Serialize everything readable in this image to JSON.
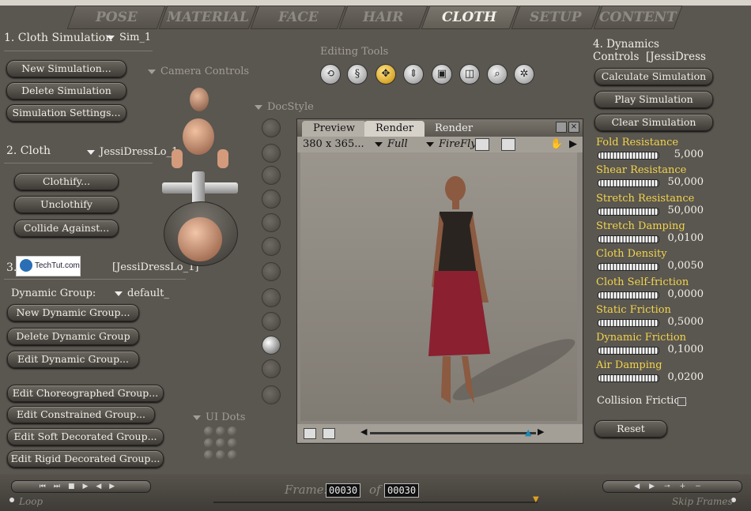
{
  "tabs": [
    "POSE",
    "MATERIAL",
    "FACE",
    "HAIR",
    "CLOTH",
    "SETUP",
    "CONTENT"
  ],
  "active_tab": "CLOTH",
  "sections": {
    "cloth_sim": {
      "title": "1. Cloth Simulation",
      "dropdown": "Sim_1",
      "buttons": [
        "New Simulation...",
        "Delete Simulation",
        "Simulation Settings..."
      ]
    },
    "cloth": {
      "title": "2. Cloth",
      "dropdown": "JessiDressLo_1",
      "buttons": [
        "Clothify...",
        "Unclothify",
        "Collide Against..."
      ]
    },
    "groups": {
      "title": "3.",
      "prop": "[JessiDressLo_1]",
      "watermark": "TechTut.com",
      "dyn_label": "Dynamic Group:",
      "dyn_value": "default_",
      "buttons": [
        "New Dynamic Group...",
        "Delete Dynamic Group",
        "Edit Dynamic Group...",
        "Edit Choreographed Group...",
        "Edit Constrained Group...",
        "Edit Soft Decorated Group...",
        "Edit Rigid Decorated Group..."
      ]
    }
  },
  "camera_controls": "Camera Controls",
  "doc_style": "DocStyle",
  "ui_dots": "UI Dots",
  "editing_tools": "Editing Tools",
  "window": {
    "tab_preview": "Preview",
    "tab_render": "Render",
    "tab_render2": "Render",
    "size": "380 x 365...",
    "mode": "Full",
    "renderer": "FireFly"
  },
  "dynamics": {
    "title": "4. Dynamics Controls",
    "figure": "[JessiDress",
    "buttons": [
      "Calculate Simulation",
      "Play Simulation",
      "Clear Simulation"
    ],
    "params": [
      {
        "label": "Fold Resistance",
        "value": "5,000"
      },
      {
        "label": "Shear Resistance",
        "value": "50,000"
      },
      {
        "label": "Stretch Resistance",
        "value": "50,000"
      },
      {
        "label": "Stretch Damping",
        "value": "0,0100"
      },
      {
        "label": "Cloth Density",
        "value": "0,0050"
      },
      {
        "label": "Cloth Self-friction",
        "value": "0,0000"
      },
      {
        "label": "Static Friction",
        "value": "0,5000"
      },
      {
        "label": "Dynamic Friction",
        "value": "0,1000"
      },
      {
        "label": "Air Damping",
        "value": "0,0200"
      }
    ],
    "collision": "Collision Friction",
    "reset": "Reset"
  },
  "timeline": {
    "frame_label": "Frame:",
    "frame": "00030",
    "of": "of",
    "total": "00030",
    "loop": "Loop",
    "skip": "Skip Frames"
  }
}
